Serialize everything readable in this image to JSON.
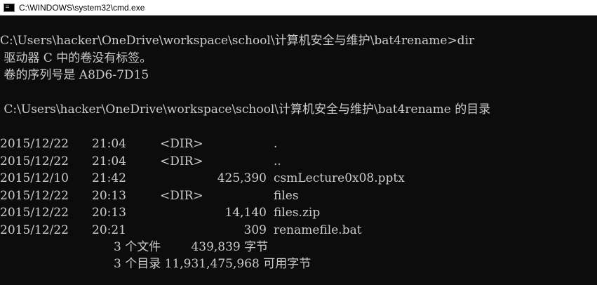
{
  "window": {
    "title": "C:\\WINDOWS\\system32\\cmd.exe",
    "icon": "console-icon"
  },
  "console": {
    "prompt_line": "C:\\Users\\hacker\\OneDrive\\workspace\\school\\计算机安全与维护\\bat4rename>dir",
    "volume_label_line": " 驱动器 C 中的卷没有标签。",
    "serial_line": " 卷的序列号是 A8D6-7D15",
    "directory_line": " C:\\Users\\hacker\\OneDrive\\workspace\\school\\计算机安全与维护\\bat4rename 的目录",
    "entries": [
      {
        "date": "2015/12/22",
        "time": "21:04",
        "type": "<DIR>",
        "size": "",
        "name": "."
      },
      {
        "date": "2015/12/22",
        "time": "21:04",
        "type": "<DIR>",
        "size": "",
        "name": ".."
      },
      {
        "date": "2015/12/10",
        "time": "21:42",
        "type": "",
        "size": "425,390",
        "name": "csmLecture0x08.pptx"
      },
      {
        "date": "2015/12/22",
        "time": "20:13",
        "type": "<DIR>",
        "size": "",
        "name": "files"
      },
      {
        "date": "2015/12/22",
        "time": "20:13",
        "type": "",
        "size": "14,140",
        "name": "files.zip"
      },
      {
        "date": "2015/12/22",
        "time": "20:21",
        "type": "",
        "size": "309",
        "name": "renamefile.bat"
      }
    ],
    "summary_files": "3 个文件        439,839 字节",
    "summary_dirs": "3 个目录 11,931,475,968 可用字节"
  }
}
